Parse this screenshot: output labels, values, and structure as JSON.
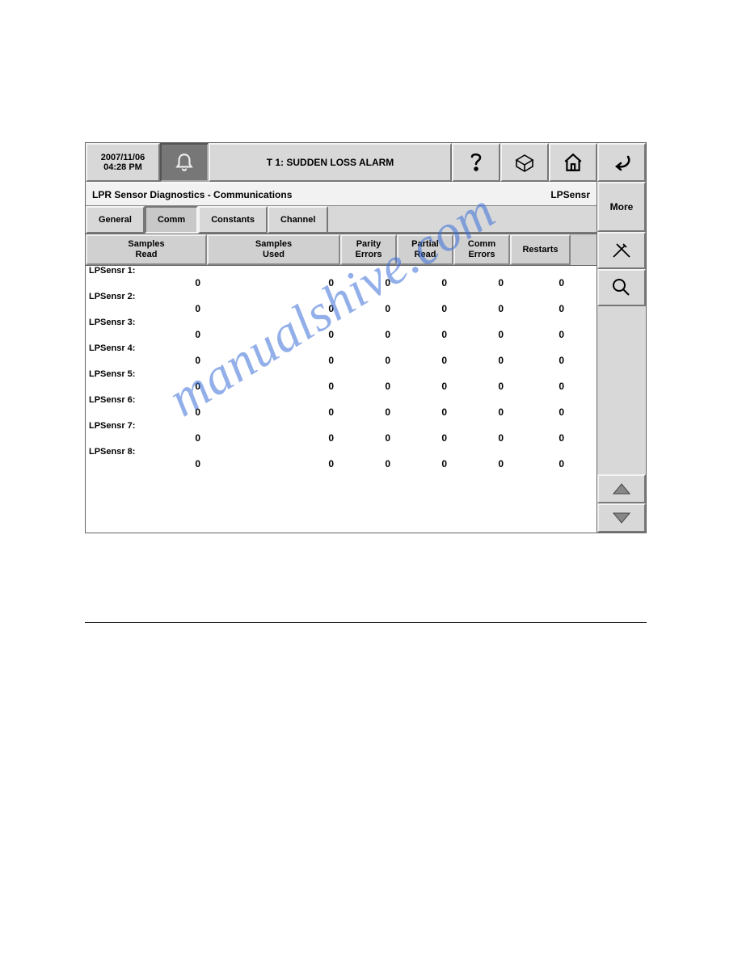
{
  "topbar": {
    "date": "2007/11/06",
    "time": "04:28 PM",
    "alarm_text": "T 1: SUDDEN LOSS ALARM"
  },
  "titlebar": {
    "title": "LPR Sensor Diagnostics - Communications",
    "devicetype": "LPSensr"
  },
  "sidepane": {
    "more_label": "More"
  },
  "tabs": {
    "general": "General",
    "comm": "Comm",
    "constants": "Constants",
    "channel": "Channel"
  },
  "columns": {
    "samples_read": "Samples\nRead",
    "samples_used": "Samples\nUsed",
    "parity_errors": "Parity\nErrors",
    "partial_read": "Partial\nRead",
    "comm_errors": "Comm\nErrors",
    "restarts": "Restarts"
  },
  "rows": [
    {
      "label": "LPSensr 1:",
      "samples_read": "0",
      "samples_used": "0",
      "parity_errors": "0",
      "partial_read": "0",
      "comm_errors": "0",
      "restarts": "0"
    },
    {
      "label": "LPSensr 2:",
      "samples_read": "0",
      "samples_used": "0",
      "parity_errors": "0",
      "partial_read": "0",
      "comm_errors": "0",
      "restarts": "0"
    },
    {
      "label": "LPSensr 3:",
      "samples_read": "0",
      "samples_used": "0",
      "parity_errors": "0",
      "partial_read": "0",
      "comm_errors": "0",
      "restarts": "0"
    },
    {
      "label": "LPSensr 4:",
      "samples_read": "0",
      "samples_used": "0",
      "parity_errors": "0",
      "partial_read": "0",
      "comm_errors": "0",
      "restarts": "0"
    },
    {
      "label": "LPSensr 5:",
      "samples_read": "0",
      "samples_used": "0",
      "parity_errors": "0",
      "partial_read": "0",
      "comm_errors": "0",
      "restarts": "0"
    },
    {
      "label": "LPSensr 6:",
      "samples_read": "0",
      "samples_used": "0",
      "parity_errors": "0",
      "partial_read": "0",
      "comm_errors": "0",
      "restarts": "0"
    },
    {
      "label": "LPSensr 7:",
      "samples_read": "0",
      "samples_used": "0",
      "parity_errors": "0",
      "partial_read": "0",
      "comm_errors": "0",
      "restarts": "0"
    },
    {
      "label": "LPSensr 8:",
      "samples_read": "0",
      "samples_used": "0",
      "parity_errors": "0",
      "partial_read": "0",
      "comm_errors": "0",
      "restarts": "0"
    }
  ],
  "watermark": "manualshive.com"
}
